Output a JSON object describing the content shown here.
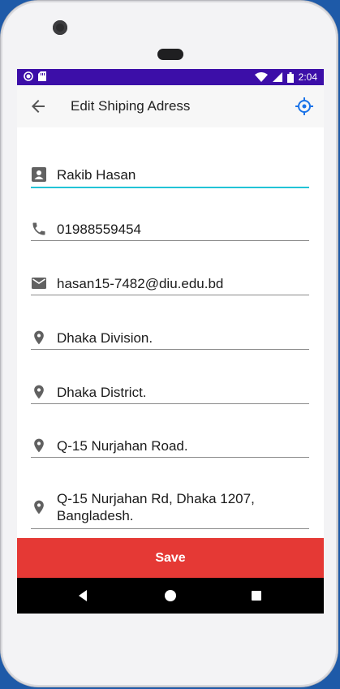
{
  "status": {
    "time": "2:04"
  },
  "appbar": {
    "title": "Edit Shiping Adress",
    "back_icon": "arrow-back-icon",
    "location_icon": "gps-fixed-icon"
  },
  "form": {
    "name": "Rakib Hasan",
    "phone": "01988559454",
    "email": "hasan15-7482@diu.edu.bd",
    "division": "Dhaka Division.",
    "district": "Dhaka District.",
    "road": "Q-15 Nurjahan Road.",
    "address_line1": "Q-15 Nurjahan Rd, Dhaka 1207,",
    "address_line2": "Bangladesh."
  },
  "actions": {
    "save_label": "Save"
  },
  "colors": {
    "statusbar": "#3c0ea8",
    "accent": "#22c3d6",
    "save": "#e53935",
    "icon": "#616161",
    "gps": "#1a73e8"
  }
}
